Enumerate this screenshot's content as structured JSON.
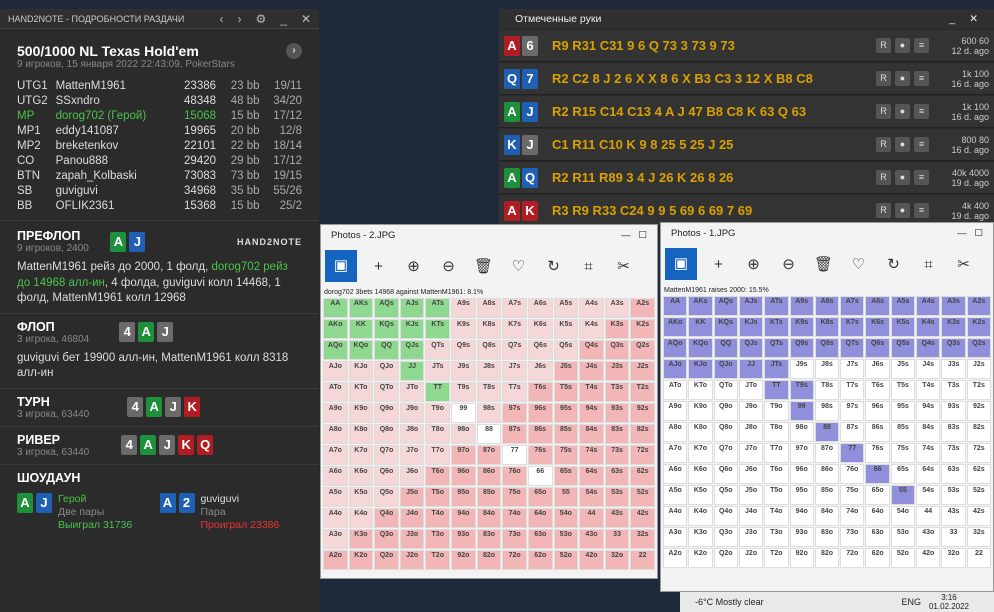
{
  "h2n": {
    "title": "HAND2NOTE - ПОДРОБНОСТИ РАЗДАЧИ",
    "game": "500/1000 NL Texas Hold'em",
    "info": "9 игроков, 15 января 2022 22:43:09, PokerStars",
    "players": [
      {
        "pos": "UTG1",
        "name": "MattenM1961",
        "stack": "23386",
        "bb": "23 bb",
        "rank": "19/11"
      },
      {
        "pos": "UTG2",
        "name": "SSxndro",
        "stack": "48348",
        "bb": "48 bb",
        "rank": "34/20"
      },
      {
        "pos": "MP",
        "name": "dorog702 (Герой)",
        "stack": "15068",
        "bb": "15 bb",
        "rank": "17/12"
      },
      {
        "pos": "MP1",
        "name": "eddy141087",
        "stack": "19965",
        "bb": "20 bb",
        "rank": "12/8"
      },
      {
        "pos": "MP2",
        "name": "breketenkov",
        "stack": "22101",
        "bb": "22 bb",
        "rank": "18/14"
      },
      {
        "pos": "CO",
        "name": "Panou888",
        "stack": "29420",
        "bb": "29 bb",
        "rank": "17/12"
      },
      {
        "pos": "BTN",
        "name": "zapah_Kolbaski",
        "stack": "73083",
        "bb": "73 bb",
        "rank": "19/15"
      },
      {
        "pos": "SB",
        "name": "guviguvi",
        "stack": "34968",
        "bb": "35 bb",
        "rank": "55/26"
      },
      {
        "pos": "BB",
        "name": "OFLIK2361",
        "stack": "15368",
        "bb": "15 bb",
        "rank": "25/2"
      }
    ],
    "preflop": {
      "title": "ПРЕФЛОП",
      "sub": "9 игроков, 2400",
      "logo": "HAND2NOTE",
      "a1": "MattenM1961 рейз до 2000, 1 фолд, ",
      "a2": "dorog702 рейз до 14968 алл-ин",
      "a3": ", 4 фолда, guviguvi колл 14468, 1 фолд, MattenM1961 колл 12968"
    },
    "flop": {
      "title": "ФЛОП",
      "sub": "3 игрока, 46804",
      "action": "guviguvi бет 19900 алл-ин, MattenM1961 колл 8318 алл-ин"
    },
    "turn": {
      "title": "ТУРН",
      "sub": "3 игрока, 63440"
    },
    "river": {
      "title": "РИВЕР",
      "sub": "3 игрока, 63440"
    },
    "showdown": {
      "title": "ШОУДАУН",
      "hero": "Герой",
      "hero_hand": "Две пары",
      "hero_res": "Выиграл 31736",
      "opp": "guviguvi",
      "opp_hand": "Пара",
      "opp_res": "Проиграл 23386"
    }
  },
  "marked": {
    "title": "Отмеченные руки",
    "rows": [
      {
        "text": "R9 R31 C31  9 6 Q 73  3 73  9 73",
        "info1": "600 60",
        "info2": "12 d. ago"
      },
      {
        "text": "R2 C2  8 J 2 6  X X  8 6  X B3 C3  3 12  X B8 C8",
        "info1": "1k 100",
        "info2": "16 d. ago"
      },
      {
        "text": "R2 R15 C14 C13  4 A J 47  B8 C8  K 63  Q 63",
        "info1": "1k 100",
        "info2": "16 d. ago"
      },
      {
        "text": "C1 R11 C10  K 9 8 25  5 25  J 25",
        "info1": "800 80",
        "info2": "16 d. ago"
      },
      {
        "text": "R2 R11 R89  3 4 J 26  K 26  8 26",
        "info1": "40k 4000",
        "info2": "19 d. ago"
      },
      {
        "text": "R3 R9 R33 C24  9 9 5 69  6 69  7 69",
        "info1": "4k 400",
        "info2": "19 d. ago"
      }
    ]
  },
  "photos2": {
    "title": "Photos - 2.JPG",
    "caption": "dorog702 3bets 14968 against MattenM1961: 8.1%"
  },
  "photos1": {
    "title": "Photos - 1.JPG",
    "caption": "MattenM1961 raises 2000: 15.5%"
  },
  "taskbar": {
    "weather": "-6°C  Mostly clear",
    "lang": "ENG",
    "time": "3:16",
    "date": "01.02.2022"
  }
}
